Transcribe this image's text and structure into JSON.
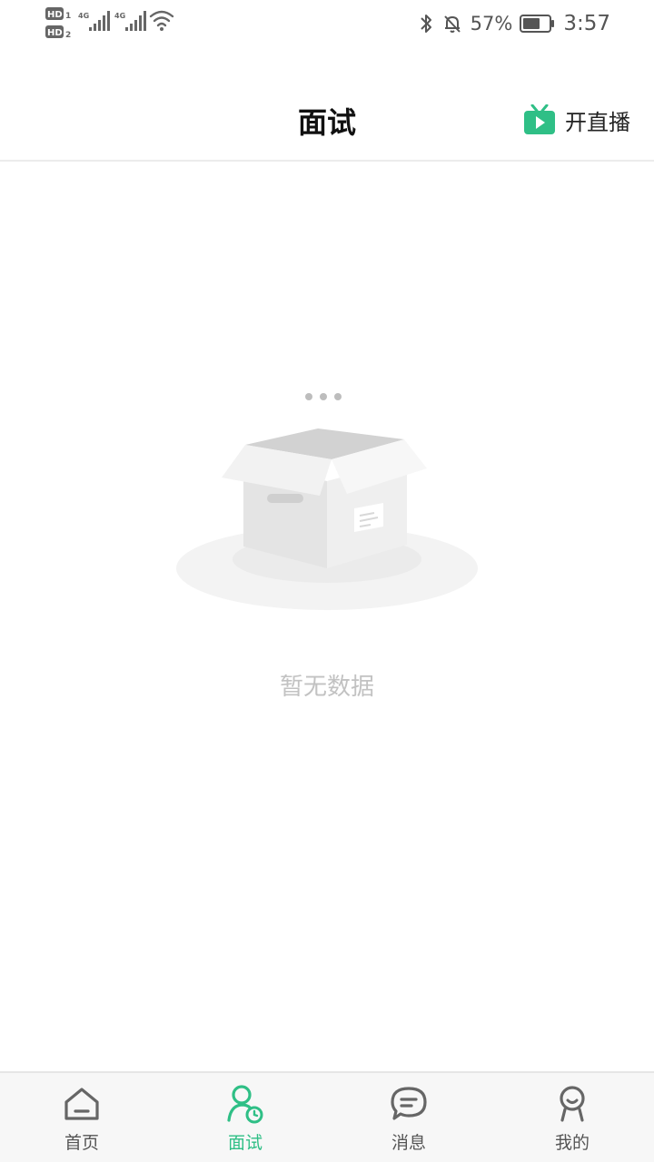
{
  "status_bar": {
    "sim1_label": "HD",
    "sim1_index": "1",
    "sim2_label": "HD",
    "sim2_index": "2",
    "network1": "4G",
    "network2": "4G",
    "battery_percent": "57%",
    "time": "3:57"
  },
  "header": {
    "title": "面试",
    "live_button_label": "开直播"
  },
  "empty_state": {
    "message": "暂无数据"
  },
  "bottom_nav": {
    "items": [
      {
        "label": "首页",
        "icon": "home-icon",
        "active": false
      },
      {
        "label": "面试",
        "icon": "interview-user-clock-icon",
        "active": true
      },
      {
        "label": "消息",
        "icon": "message-bubble-icon",
        "active": false
      },
      {
        "label": "我的",
        "icon": "profile-smile-icon",
        "active": false
      }
    ]
  },
  "colors": {
    "accent": "#2fbf86",
    "text_primary": "#111111",
    "text_muted": "#c2c2c2",
    "icon_gray": "#666666",
    "nav_bg": "#f7f7f7"
  }
}
